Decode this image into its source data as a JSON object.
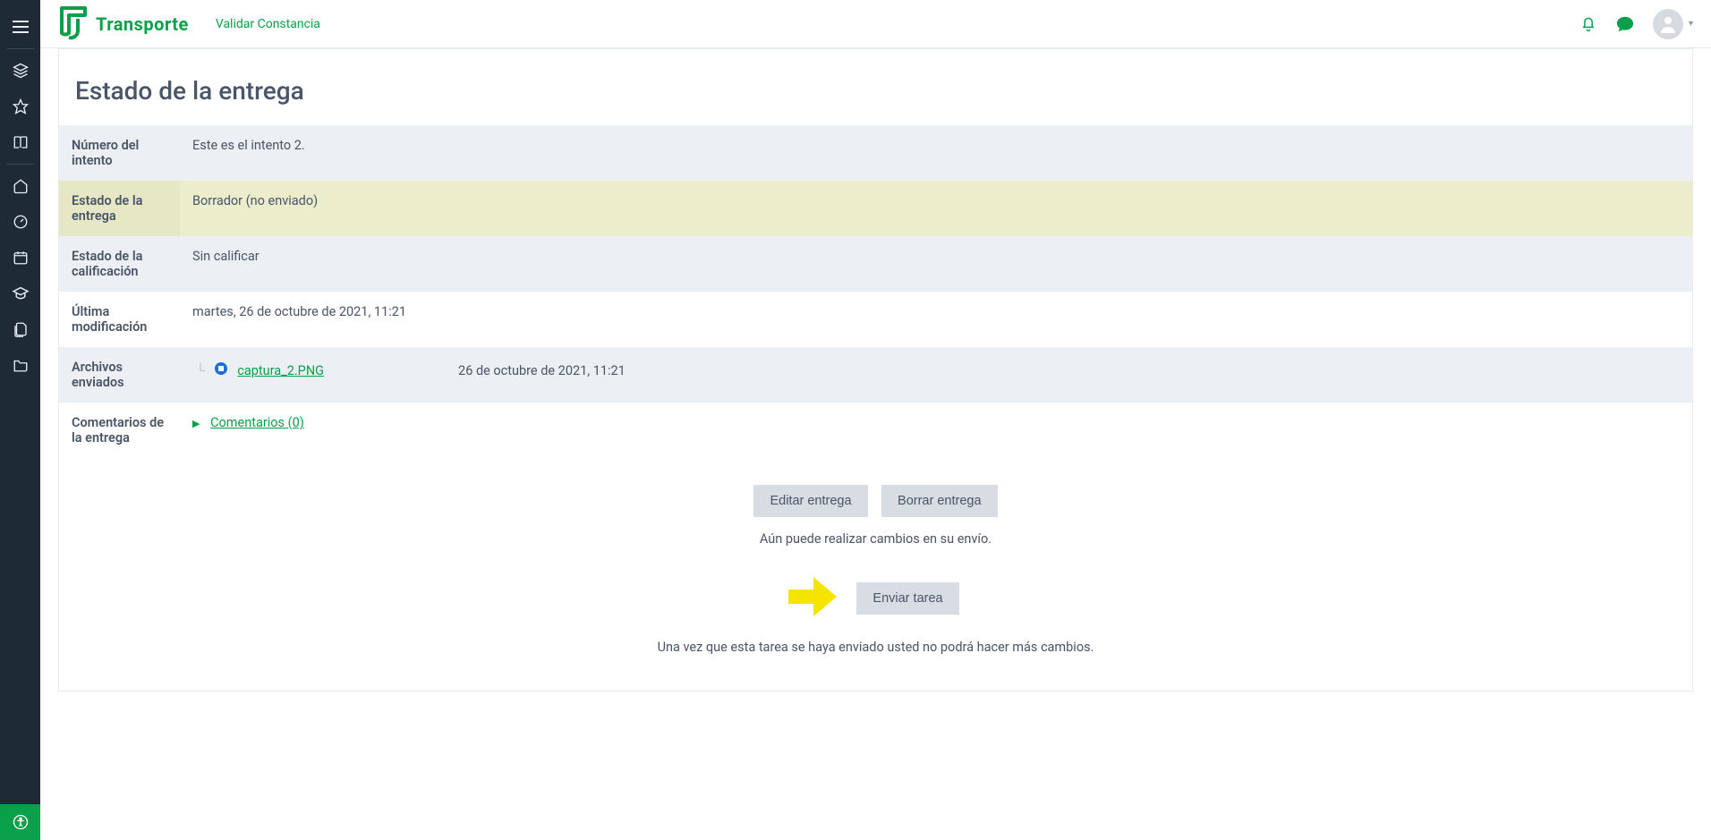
{
  "brand": {
    "name": "Transporte"
  },
  "topbar": {
    "validar": "Validar Constancia"
  },
  "page": {
    "title": "Estado de la entrega"
  },
  "rows": {
    "attempt": {
      "label": "Número del intento",
      "value": "Este es el intento 2."
    },
    "status": {
      "label": "Estado de la entrega",
      "value": "Borrador (no enviado)"
    },
    "grade": {
      "label": "Estado de la calificación",
      "value": "Sin calificar"
    },
    "modified": {
      "label": "Última modificación",
      "value": "martes, 26 de octubre de 2021, 11:21"
    },
    "files": {
      "label": "Archivos enviados"
    },
    "comments": {
      "label": "Comentarios de la entrega"
    }
  },
  "file": {
    "name": "captura_2.PNG",
    "date": "26 de octubre de 2021, 11:21"
  },
  "comments_link": "Comentarios (0)",
  "buttons": {
    "edit": "Editar entrega",
    "delete": "Borrar entrega",
    "submit": "Enviar tarea"
  },
  "hints": {
    "can_change": "Aún puede realizar cambios en su envío.",
    "final": "Una vez que esta tarea se haya enviado usted no podrá hacer más cambios."
  }
}
